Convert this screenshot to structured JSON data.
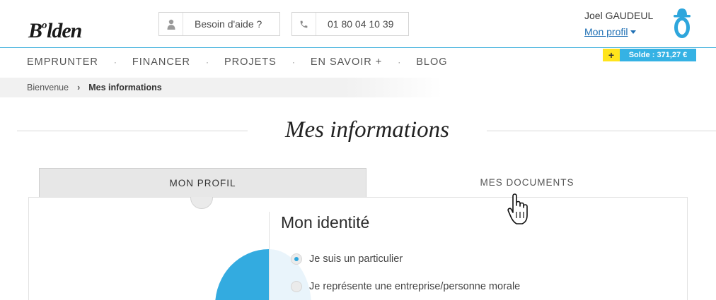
{
  "header": {
    "logo_main": "B",
    "logo_sup": "o",
    "logo_rest": "lden",
    "help_icon": "person-icon",
    "help_label": "Besoin d'aide ?",
    "phone_icon": "phone-icon",
    "phone_number": "01 80 04 10 39",
    "user_name": "Joel GAUDEUL",
    "profile_link": "Mon profil",
    "avatar_icon": "bowler-hat-mascot-icon"
  },
  "balance": {
    "plus_label": "+",
    "amount_label": "Solde : 371,27 €"
  },
  "nav": {
    "items": [
      "EMPRUNTER",
      "FINANCER",
      "PROJETS",
      "EN SAVOIR +",
      "BLOG"
    ],
    "separator": "·"
  },
  "breadcrumb": {
    "home": "Bienvenue",
    "separator": "›",
    "current": "Mes informations"
  },
  "page": {
    "title": "Mes informations"
  },
  "tabs": {
    "profil": "MON PROFIL",
    "documents": "MES DOCUMENTS",
    "active": "profil"
  },
  "identity": {
    "title": "Mon identité",
    "options": [
      "Je suis un particulier",
      "Je représente une entreprise/personne morale"
    ],
    "selected_index": 0
  },
  "colors": {
    "accent": "#35b2e4",
    "plus_yellow": "#ffe41c",
    "link": "#1e6fb4"
  }
}
